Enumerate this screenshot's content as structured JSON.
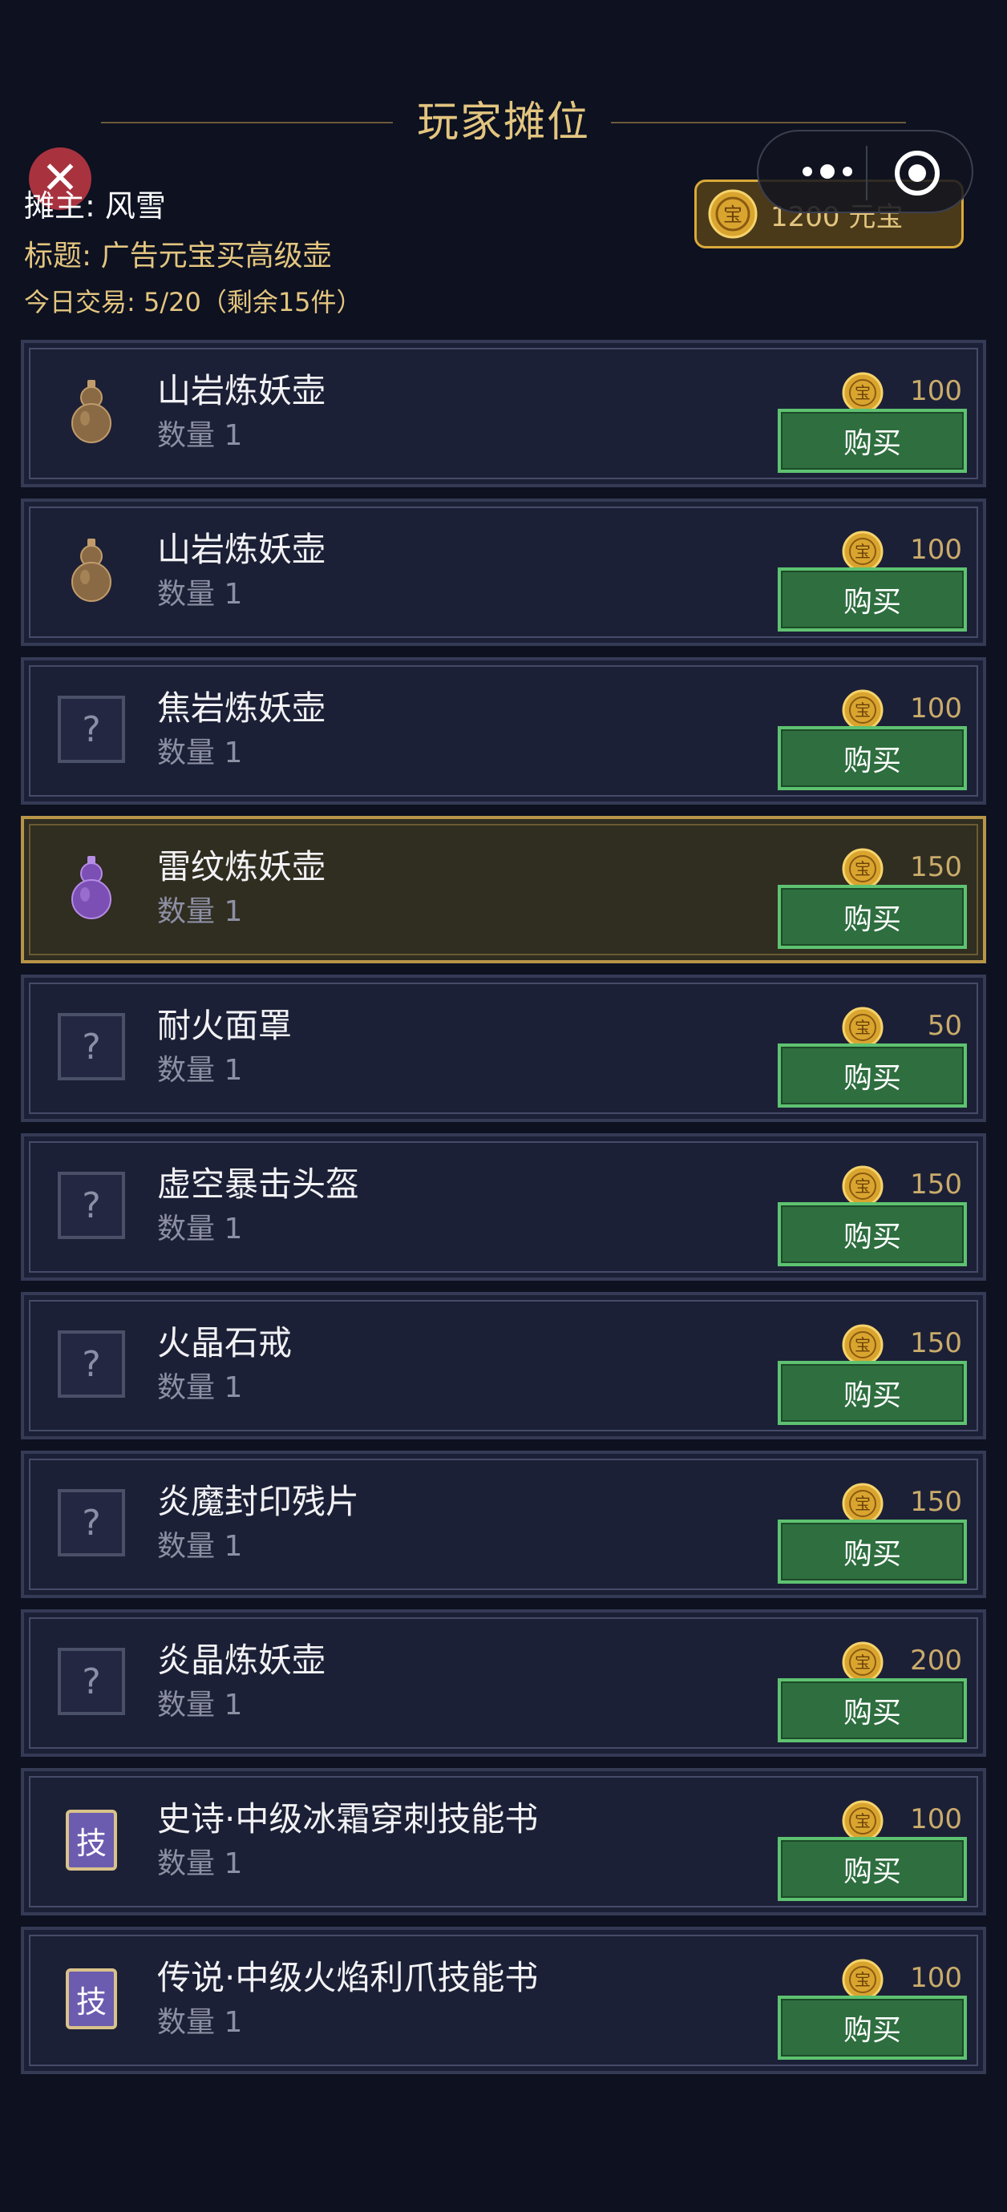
{
  "header": {
    "title": "玩家摊位",
    "owner": "摊主: 风雪",
    "stall_title": "标题: 广告元宝买高级壶",
    "trade_info": "今日交易: 5/20（剩余15件）"
  },
  "balance": {
    "text": "1200 元宝",
    "coin_glyph": "宝"
  },
  "close_icon": "close-icon",
  "buy_label": "购买",
  "items": [
    {
      "name": "山岩炼妖壶",
      "qty": "数量 1",
      "price": "100",
      "icon": "gourd-brown"
    },
    {
      "name": "山岩炼妖壶",
      "qty": "数量 1",
      "price": "100",
      "icon": "gourd-brown"
    },
    {
      "name": "焦岩炼妖壶",
      "qty": "数量 1",
      "price": "100",
      "icon": "unknown",
      "icon_text": "?"
    },
    {
      "name": "雷纹炼妖壶",
      "qty": "数量 1",
      "price": "150",
      "icon": "gourd-purple",
      "highlight": true
    },
    {
      "name": "耐火面罩",
      "qty": "数量 1",
      "price": "50",
      "icon": "unknown",
      "icon_text": "?"
    },
    {
      "name": "虚空暴击头盔",
      "qty": "数量 1",
      "price": "150",
      "icon": "unknown",
      "icon_text": "?"
    },
    {
      "name": "火晶石戒",
      "qty": "数量 1",
      "price": "150",
      "icon": "unknown",
      "icon_text": "?"
    },
    {
      "name": "炎魔封印残片",
      "qty": "数量 1",
      "price": "150",
      "icon": "unknown",
      "icon_text": "?"
    },
    {
      "name": "炎晶炼妖壶",
      "qty": "数量 1",
      "price": "200",
      "icon": "unknown",
      "icon_text": "?"
    },
    {
      "name": "史诗·中级冰霜穿刺技能书",
      "qty": "数量 1",
      "price": "100",
      "icon": "skill-book",
      "icon_text": "技"
    },
    {
      "name": "传说·中级火焰利爪技能书",
      "qty": "数量 1",
      "price": "100",
      "icon": "skill-book",
      "icon_text": "技"
    }
  ],
  "colors": {
    "accent_gold": "#e3c57f",
    "buy_green": "#2e6e3f",
    "card_bg": "#1c2036",
    "highlight_bg": "#302d21"
  }
}
